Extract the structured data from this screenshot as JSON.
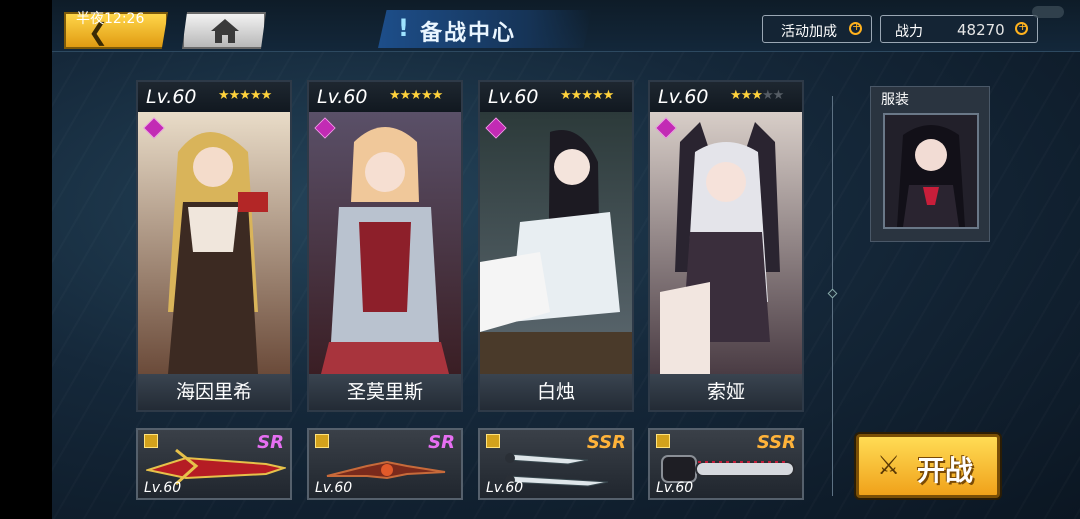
{
  "status": {
    "time": "半夜12:26"
  },
  "header": {
    "title": "备战中心",
    "title_mark": "!",
    "bonus_label": "活动加成",
    "power_label": "战力",
    "power_value": "48270"
  },
  "characters": [
    {
      "level": "Lv.60",
      "stars": 5,
      "max_stars": 5,
      "name": "海因里希"
    },
    {
      "level": "Lv.60",
      "stars": 5,
      "max_stars": 5,
      "name": "圣莫里斯"
    },
    {
      "level": "Lv.60",
      "stars": 5,
      "max_stars": 5,
      "name": "白烛"
    },
    {
      "level": "Lv.60",
      "stars": 3,
      "max_stars": 5,
      "name": "索娅"
    }
  ],
  "weapons": [
    {
      "rarity": "SR",
      "level": "Lv.60"
    },
    {
      "rarity": "SR",
      "level": "Lv.60"
    },
    {
      "rarity": "SSR",
      "level": "Lv.60"
    },
    {
      "rarity": "SSR",
      "level": "Lv.60"
    }
  ],
  "outfit": {
    "label": "服装"
  },
  "battle_button": {
    "label": "开战"
  },
  "colors": {
    "accent": "#f0a21a",
    "title_blue": "#1d4e8a",
    "sr": "#e66ff2",
    "ssr": "#ffb33a"
  }
}
